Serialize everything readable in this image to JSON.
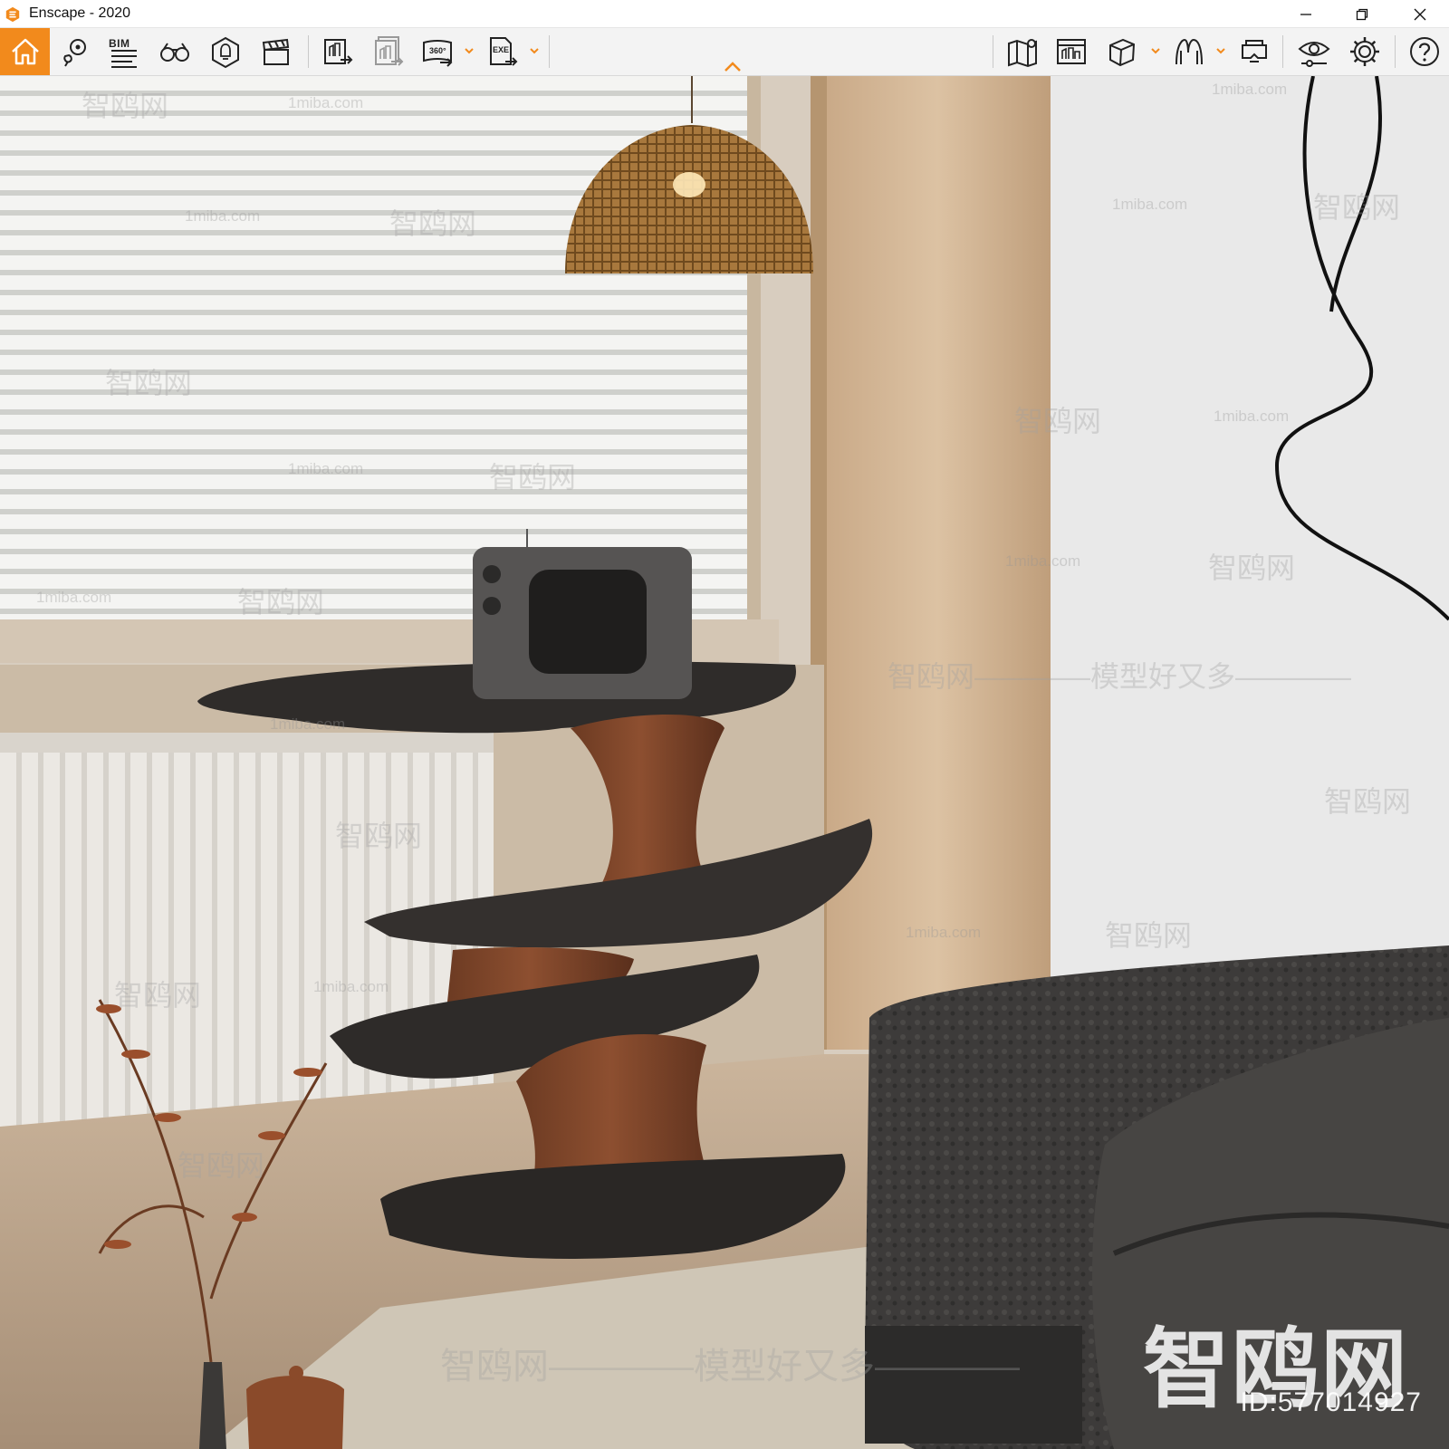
{
  "window": {
    "title": "Enscape - 2020",
    "minimize_label": "Minimize",
    "restore_label": "Restore",
    "close_label": "Close"
  },
  "toolbar": {
    "accent_color": "#f28a1c",
    "bim_label": "BIM",
    "left_tools": [
      {
        "name": "home",
        "icon": "home-icon"
      },
      {
        "name": "views",
        "icon": "location-views-icon"
      },
      {
        "name": "bim",
        "icon": "bim-info-icon"
      },
      {
        "name": "binoculars",
        "icon": "binoculars-icon"
      },
      {
        "name": "light",
        "icon": "light-view-icon"
      },
      {
        "name": "video",
        "icon": "clapperboard-icon"
      },
      {
        "name": "export-render",
        "icon": "export-image-icon"
      },
      {
        "name": "batch-render",
        "icon": "batch-render-icon"
      },
      {
        "name": "panorama",
        "icon": "panorama-360-icon"
      },
      {
        "name": "exe-export",
        "icon": "exe-export-icon"
      }
    ],
    "right_tools": [
      {
        "name": "map",
        "icon": "map-icon"
      },
      {
        "name": "gallery",
        "icon": "gallery-icon"
      },
      {
        "name": "asset",
        "icon": "cube-asset-icon"
      },
      {
        "name": "material",
        "icon": "material-icon"
      },
      {
        "name": "vr",
        "icon": "vr-headset-icon"
      },
      {
        "name": "visual-settings",
        "icon": "eye-settings-icon"
      },
      {
        "name": "settings",
        "icon": "gear-icon"
      },
      {
        "name": "help",
        "icon": "help-icon"
      }
    ]
  },
  "viewport": {
    "watermark_small": "1miba.com",
    "watermark_cn": "智鸥网",
    "watermark_slogan": "智鸥网————模型好又多————",
    "watermark_big": "智鸥网",
    "watermark_id": "ID:577014927"
  }
}
